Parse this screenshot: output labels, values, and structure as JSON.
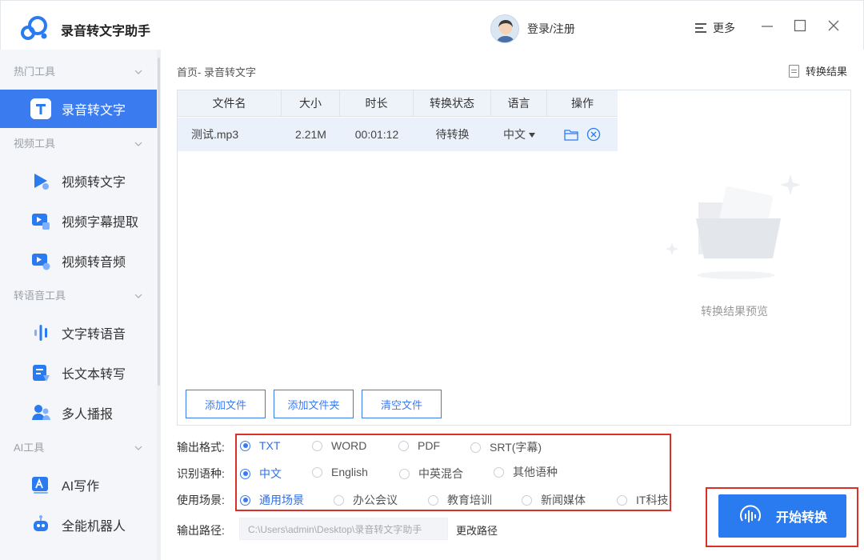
{
  "app": {
    "title": "录音转文字助手",
    "login": "登录/注册",
    "more": "更多"
  },
  "sidebar": {
    "sections": [
      {
        "label": "热门工具"
      },
      {
        "label": "视频工具"
      },
      {
        "label": "转语音工具"
      },
      {
        "label": "AI工具"
      }
    ],
    "items": [
      {
        "label": "录音转文字",
        "icon": "text-t-icon",
        "active": true
      },
      {
        "label": "视频转文字",
        "icon": "video-play-icon"
      },
      {
        "label": "视频字幕提取",
        "icon": "subtitle-extract-icon"
      },
      {
        "label": "视频转音频",
        "icon": "video-audio-icon"
      },
      {
        "label": "文字转语音",
        "icon": "soundwave-icon"
      },
      {
        "label": "长文本转写",
        "icon": "long-text-icon"
      },
      {
        "label": "多人播报",
        "icon": "multi-speaker-icon"
      },
      {
        "label": "AI写作",
        "icon": "ai-write-icon"
      },
      {
        "label": "全能机器人",
        "icon": "robot-icon"
      }
    ]
  },
  "main": {
    "breadcrumb": "首页- 录音转文字",
    "result_link": "转换结果",
    "table": {
      "headers": [
        "文件名",
        "大小",
        "时长",
        "转换状态",
        "语言",
        "操作"
      ],
      "rows": [
        {
          "name": "测试.mp3",
          "size": "2.21M",
          "duration": "00:01:12",
          "status": "待转换",
          "language": "中文"
        }
      ]
    },
    "buttons": {
      "add_file": "添加文件",
      "add_folder": "添加文件夹",
      "clear": "清空文件"
    },
    "preview_text": "转换结果预览"
  },
  "options": {
    "format": {
      "label": "输出格式:",
      "choices": [
        "TXT",
        "WORD",
        "PDF",
        "SRT(字幕)"
      ],
      "selected": "TXT"
    },
    "language": {
      "label": "识别语种:",
      "choices": [
        "中文",
        "English",
        "中英混合",
        "其他语种"
      ],
      "selected": "中文"
    },
    "scene": {
      "label": "使用场景:",
      "choices": [
        "通用场景",
        "办公会议",
        "教育培训",
        "新闻媒体",
        "IT科技"
      ],
      "selected": "通用场景"
    },
    "path": {
      "label": "输出路径:",
      "value": "C:\\Users\\admin\\Desktop\\录音转文字助手",
      "change": "更改路径"
    }
  },
  "start_button": "开始转换",
  "colors": {
    "accent": "#3b7bf0",
    "highlight_border": "#d9302a"
  }
}
